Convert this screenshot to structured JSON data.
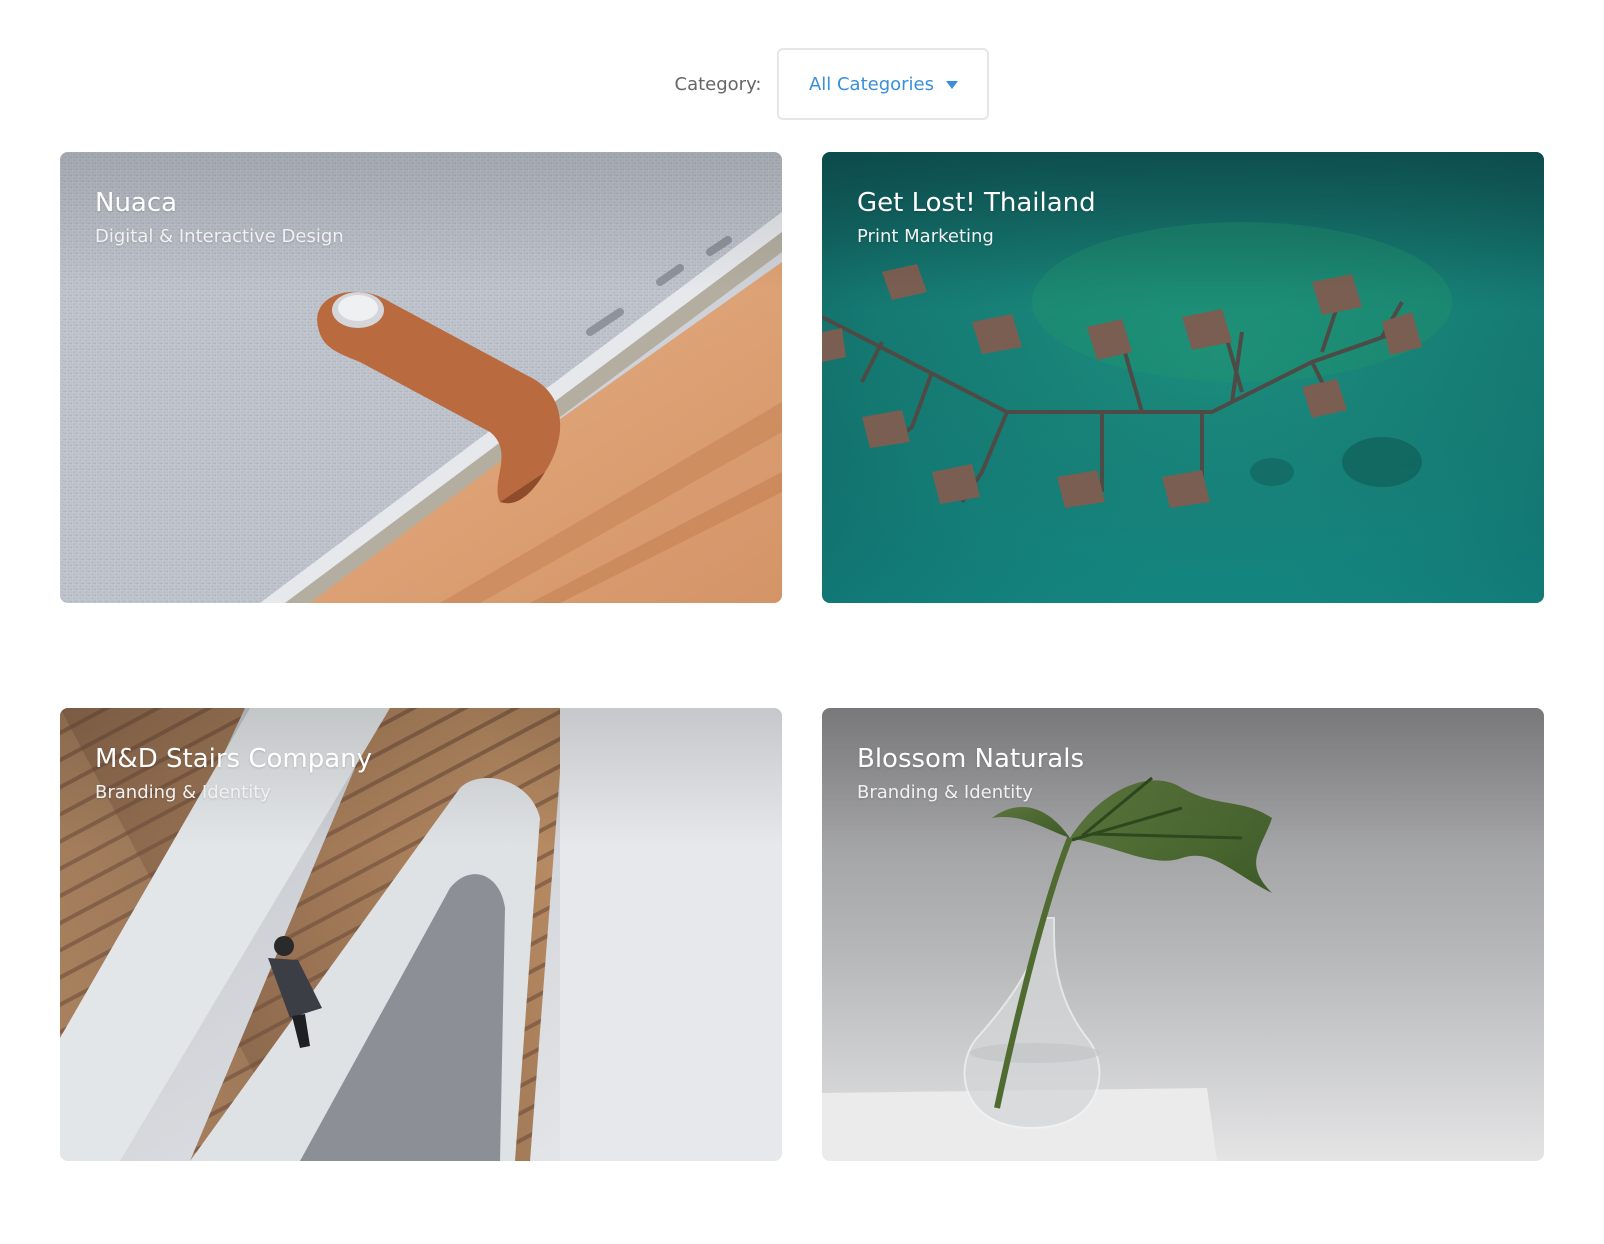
{
  "filter": {
    "label": "Category:",
    "selected": "All Categories"
  },
  "projects": [
    {
      "title": "Nuaca",
      "category": "Digital & Interactive Design"
    },
    {
      "title": "Get Lost! Thailand",
      "category": "Print Marketing"
    },
    {
      "title": "M&D Stairs Company",
      "category": "Branding & Identity"
    },
    {
      "title": "Blossom Naturals",
      "category": "Branding & Identity"
    }
  ],
  "colors": {
    "accent": "#3a8fd9",
    "label": "#666666",
    "border": "#e6e6e6"
  },
  "icons": {
    "dropdown": "caret-down-icon"
  }
}
